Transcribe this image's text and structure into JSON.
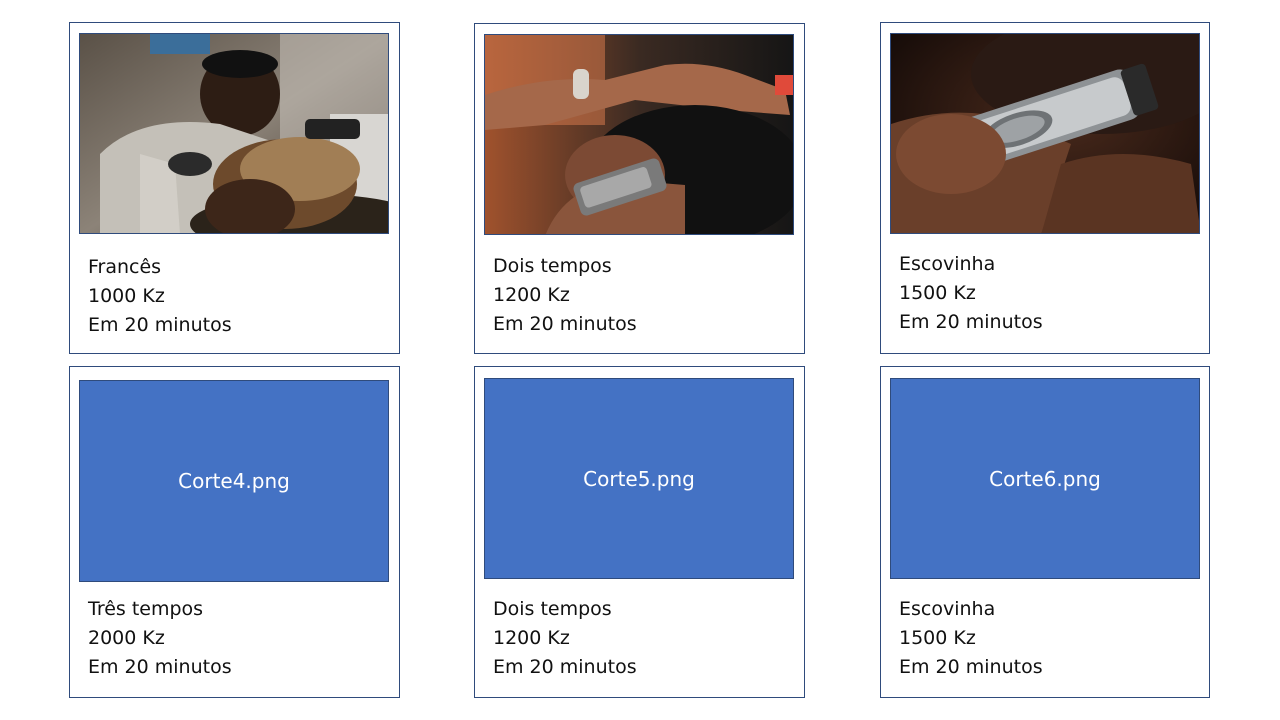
{
  "cards": [
    {
      "name": "Francês",
      "price": "1000 Kz",
      "duration": "Em 20 minutos",
      "image": "barber-fade-photo"
    },
    {
      "name": "Dois tempos",
      "price": "1200 Kz",
      "duration": "Em 20 minutos",
      "image": "barber-clipper-photo"
    },
    {
      "name": "Escovinha",
      "price": "1500 Kz",
      "duration": "Em 20 minutos",
      "image": "clipper-closeup-photo"
    },
    {
      "name": "Três tempos",
      "price": "2000 Kz",
      "duration": "Em 20 minutos",
      "image_label": "Corte4.png"
    },
    {
      "name": "Dois tempos",
      "price": "1200 Kz",
      "duration": "Em 20 minutos",
      "image_label": "Corte5.png"
    },
    {
      "name": "Escovinha",
      "price": "1500 Kz",
      "duration": "Em 20 minutos",
      "image_label": "Corte6.png"
    }
  ],
  "colors": {
    "placeholder_fill": "#4472c4",
    "card_border": "#2f4b7c"
  }
}
